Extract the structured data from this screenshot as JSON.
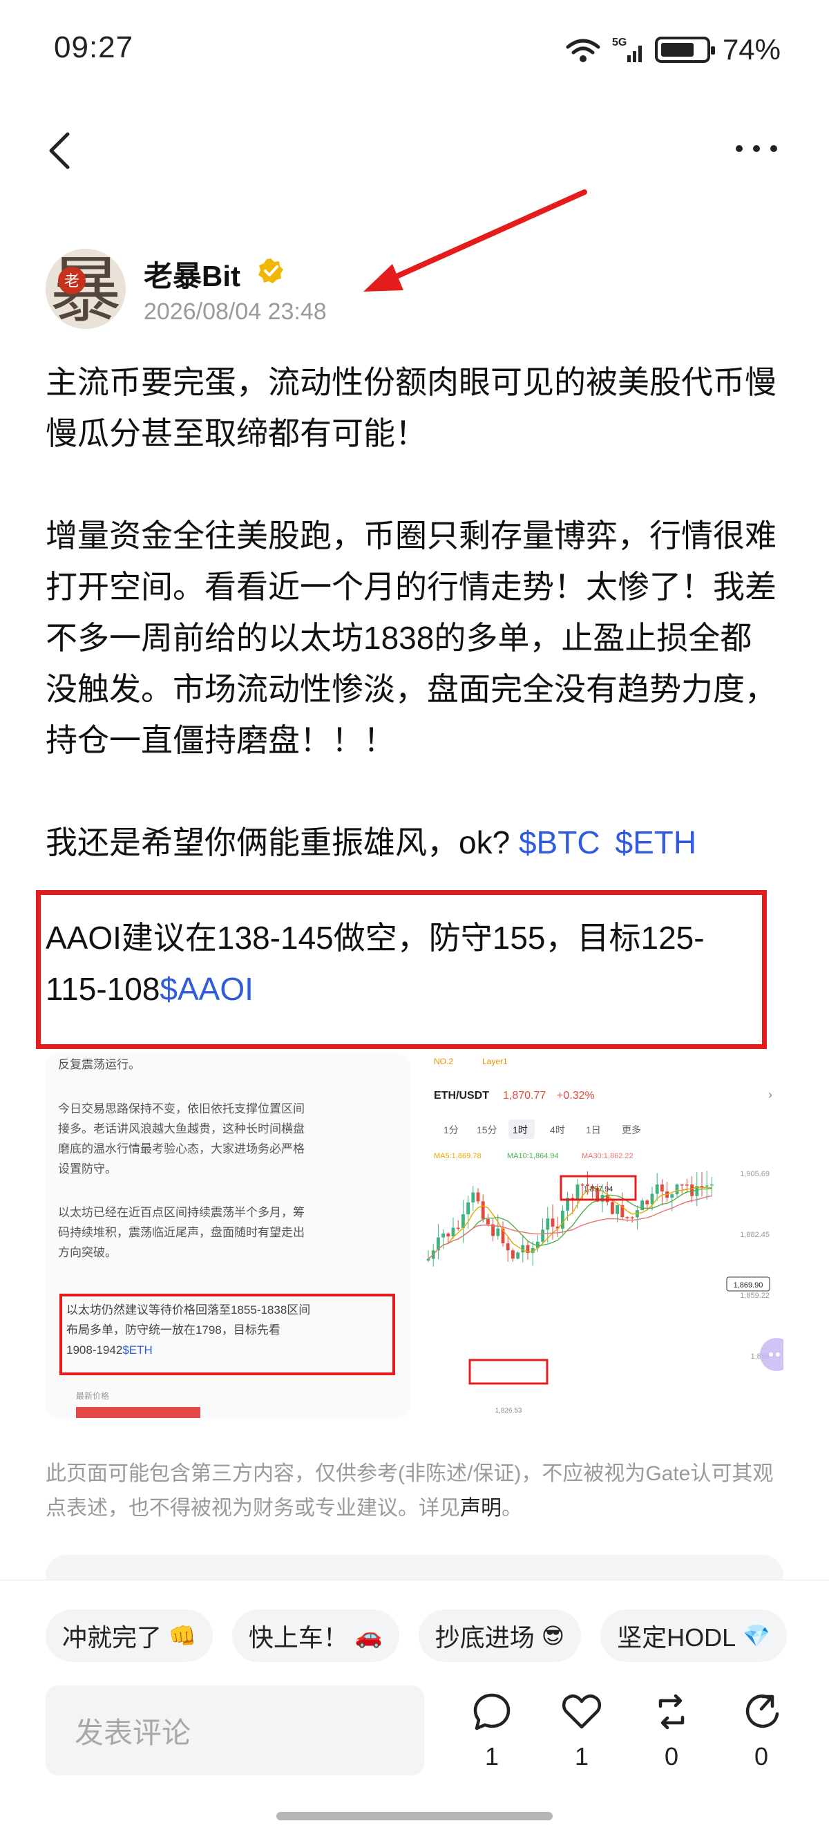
{
  "status_bar": {
    "time": "09:27",
    "network_label": "5G",
    "wifi_label": "6",
    "battery_percent": "74%",
    "battery_level": 0.74
  },
  "header": {
    "back_icon": "chevron-left-icon",
    "more_icon": "more-horizontal-icon"
  },
  "author": {
    "name": "老暴Bit",
    "avatar_text_1": "老",
    "avatar_text_2": "暴",
    "timestamp": "2026/08/04 23:48",
    "verified_color": "#f2b705"
  },
  "post": {
    "paragraph_1": "主流币要完蛋，流动性份额肉眼可见的被美股代币慢慢瓜分甚至取缔都有可能！",
    "paragraph_2": "增量资金全往美股跑，币圈只剩存量博弈，行情很难打开空间。看看近一个月的行情走势！太惨了！我差不多一周前给的以太坊1838的多单，止盈止损全都没触发。市场流动性惨淡，盘面完全没有趋势力度，持仓一直僵持磨盘！！！",
    "paragraph_3_text": "我还是希望你俩能重振雄风，ok?",
    "tag_btc": "$BTC",
    "tag_eth": "$ETH",
    "highlight_text": "AAOI建议在138-145做空，防守155，目标125-115-108",
    "tag_aaoi": "$AAOI",
    "tag_color": "#2f5bdc",
    "highlight_color": "#e51c1c"
  },
  "image_left": {
    "line_1": "反复震荡运行。",
    "line_2": "今日交易思路保持不变，依旧依托支撑位置区间",
    "line_3": "接多。老话讲风浪越大鱼越贵，这种长时间横盘",
    "line_4": "磨底的温水行情最考验心态，大家进场务必严格",
    "line_5": "设置防守。",
    "line_6": "以太坊已经在近百点区间持续震荡半个多月，筹",
    "line_7": "码持续堆积，震荡临近尾声，盘面随时有望走出",
    "line_8": "方向突破。",
    "boxed_1": "以太坊仍然建议等待价格回落至1855-1838区间",
    "boxed_2": "布局多单，防守统一放在1798，目标先看",
    "boxed_3": "1908-1942",
    "boxed_tag": "$ETH",
    "footer": "最新价格"
  },
  "image_right": {
    "top_label": "NO.2",
    "top_label_2": "Layer1",
    "pair": "ETH/USDT",
    "price": "1,870.77",
    "change": "+0.32%",
    "tabs": [
      "1分",
      "15分",
      "1时",
      "4时",
      "1日",
      "更多"
    ],
    "ma_1": "MA5:1,869.78",
    "ma_2": "MA10:1,864.94",
    "ma_3": "MA30:1,862.22",
    "y_top": "1,905.69",
    "y_2": "1,882.45",
    "y_3": "1,859.22",
    "y_4": "1,836",
    "current_tag": "1,869.90",
    "high_label": "1,897.94",
    "low_label": "1,826.53"
  },
  "disclaimer": {
    "text": "此页面可能包含第三方内容，仅供参考(非陈述/保证)，不应被视为Gate认可其观点表述，也不得被视为财务或专业建议。详见",
    "link": "声明",
    "end": "。"
  },
  "reactions": [
    {
      "label": "冲就完了",
      "emoji": "👊"
    },
    {
      "label": "快上车！",
      "emoji": "🚗"
    },
    {
      "label": "抄底进场",
      "emoji": "😎"
    },
    {
      "label": "坚定HODL",
      "emoji": "💎"
    }
  ],
  "comment": {
    "placeholder": "发表评论"
  },
  "actions": {
    "comments": "1",
    "likes": "1",
    "reposts": "0",
    "shares": "0"
  }
}
